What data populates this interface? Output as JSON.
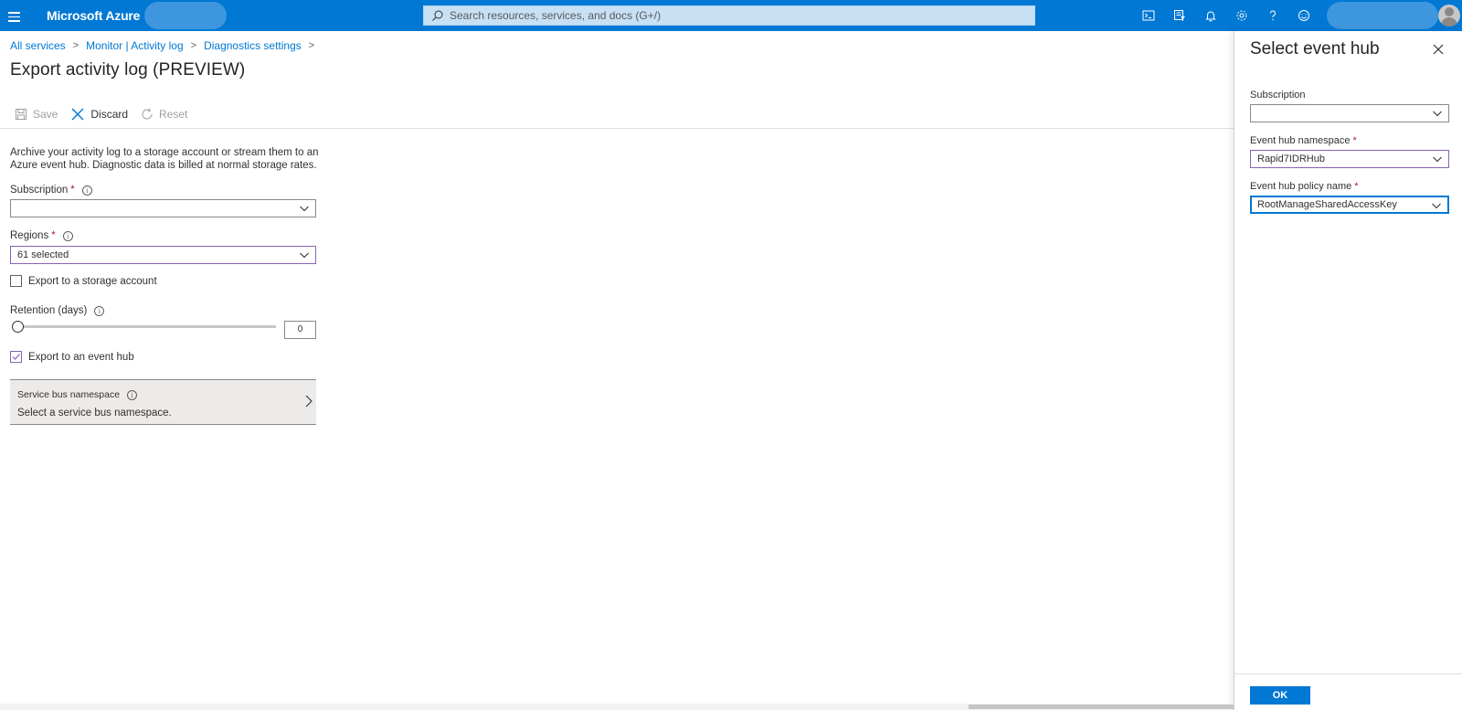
{
  "topbar": {
    "brand": "Microsoft Azure",
    "search_placeholder": "Search resources, services, and docs (G+/)",
    "icons": [
      "cloud-shell-icon",
      "directory-filter-icon",
      "notifications-icon",
      "settings-icon",
      "help-icon",
      "feedback-icon"
    ],
    "accent": "#0078d4"
  },
  "breadcrumb": {
    "items": [
      "All services",
      "Monitor | Activity log",
      "Diagnostics settings"
    ]
  },
  "page": {
    "title": "Export activity log (PREVIEW)"
  },
  "toolbar": {
    "save_label": "Save",
    "discard_label": "Discard",
    "reset_label": "Reset"
  },
  "form": {
    "description": "Archive your activity log to a storage account or stream them to an Azure event hub. Diagnostic data is billed at normal storage rates.",
    "subscription_label": "Subscription",
    "subscription_value": "",
    "regions_label": "Regions",
    "regions_value": "61 selected",
    "storage_checkbox_label": "Export to a storage account",
    "storage_checked": false,
    "retention_label": "Retention (days)",
    "retention_value": "0",
    "eventhub_checkbox_label": "Export to an event hub",
    "eventhub_checked": true,
    "service_bus_title": "Service bus namespace",
    "service_bus_value": "Select a service bus namespace."
  },
  "panel": {
    "title": "Select event hub",
    "subscription_label": "Subscription",
    "subscription_value": "",
    "namespace_label": "Event hub namespace",
    "namespace_value": "Rapid7IDRHub",
    "policy_label": "Event hub policy name",
    "policy_value": "RootManageSharedAccessKey",
    "ok_label": "OK"
  },
  "required_marker": "*",
  "info_glyph": "i"
}
